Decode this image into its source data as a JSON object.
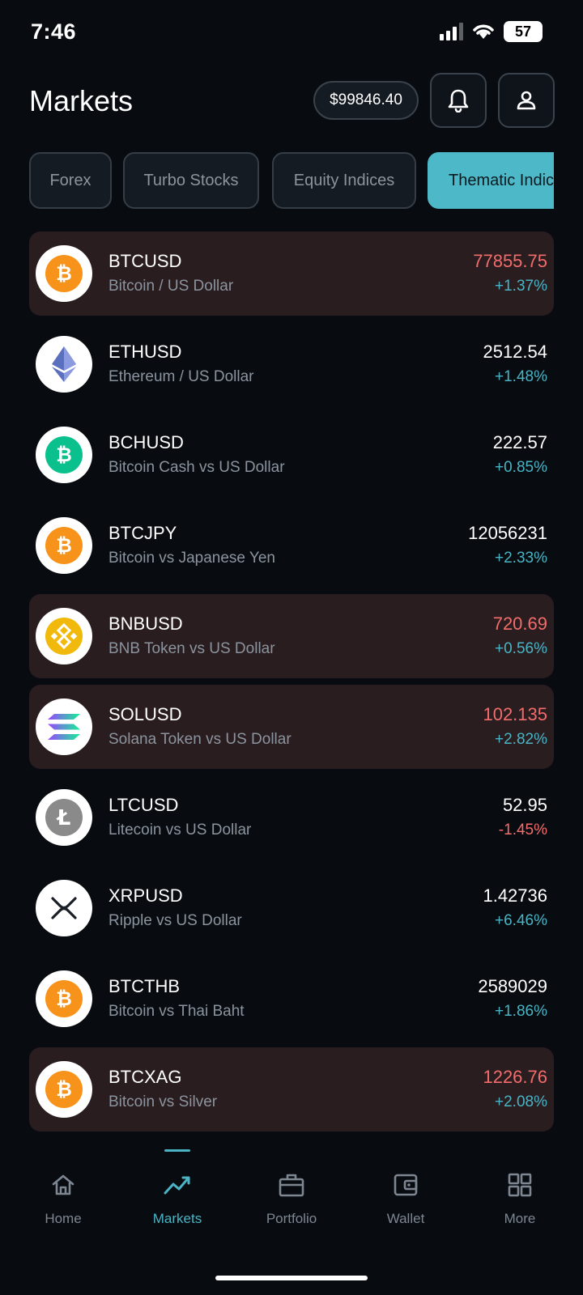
{
  "status_bar": {
    "time": "7:46",
    "battery": "57"
  },
  "header": {
    "title": "Markets",
    "balance": "$99846.40"
  },
  "tabs": [
    {
      "label": "Forex"
    },
    {
      "label": "Turbo Stocks"
    },
    {
      "label": "Equity Indices"
    },
    {
      "label": "Thematic Indic"
    }
  ],
  "markets": [
    {
      "symbol": "BTCUSD",
      "name": "Bitcoin / US Dollar",
      "price": "77855.75",
      "change": "+1.37%",
      "icon": "bitcoin-icon"
    },
    {
      "symbol": "ETHUSD",
      "name": "Ethereum / US Dollar",
      "price": "2512.54",
      "change": "+1.48%",
      "icon": "ethereum-icon"
    },
    {
      "symbol": "BCHUSD",
      "name": "Bitcoin Cash vs US Dollar",
      "price": "222.57",
      "change": "+0.85%",
      "icon": "bitcoin-cash-icon"
    },
    {
      "symbol": "BTCJPY",
      "name": "Bitcoin vs Japanese Yen",
      "price": "12056231",
      "change": "+2.33%",
      "icon": "bitcoin-icon"
    },
    {
      "symbol": "BNBUSD",
      "name": "BNB Token vs US Dollar",
      "price": "720.69",
      "change": "+0.56%",
      "icon": "bnb-icon"
    },
    {
      "symbol": "SOLUSD",
      "name": "Solana Token vs US Dollar",
      "price": "102.135",
      "change": "+2.82%",
      "icon": "solana-icon"
    },
    {
      "symbol": "LTCUSD",
      "name": "Litecoin vs US Dollar",
      "price": "52.95",
      "change": "-1.45%",
      "icon": "litecoin-icon"
    },
    {
      "symbol": "XRPUSD",
      "name": "Ripple vs US Dollar",
      "price": "1.42736",
      "change": "+6.46%",
      "icon": "xrp-icon"
    },
    {
      "symbol": "BTCTHB",
      "name": "Bitcoin vs Thai Baht",
      "price": "2589029",
      "change": "+1.86%",
      "icon": "bitcoin-icon"
    },
    {
      "symbol": "BTCXAG",
      "name": "Bitcoin vs Silver",
      "price": "1226.76",
      "change": "+2.08%",
      "icon": "bitcoin-icon"
    }
  ],
  "nav": [
    {
      "label": "Home",
      "icon": "home-icon"
    },
    {
      "label": "Markets",
      "icon": "chart-icon"
    },
    {
      "label": "Portfolio",
      "icon": "briefcase-icon"
    },
    {
      "label": "Wallet",
      "icon": "wallet-icon"
    },
    {
      "label": "More",
      "icon": "grid-icon"
    }
  ],
  "colors": {
    "accent": "#4cb8c8",
    "down": "#f26c6c",
    "highlight_row": "#2a1d1f",
    "background": "#080c10"
  }
}
